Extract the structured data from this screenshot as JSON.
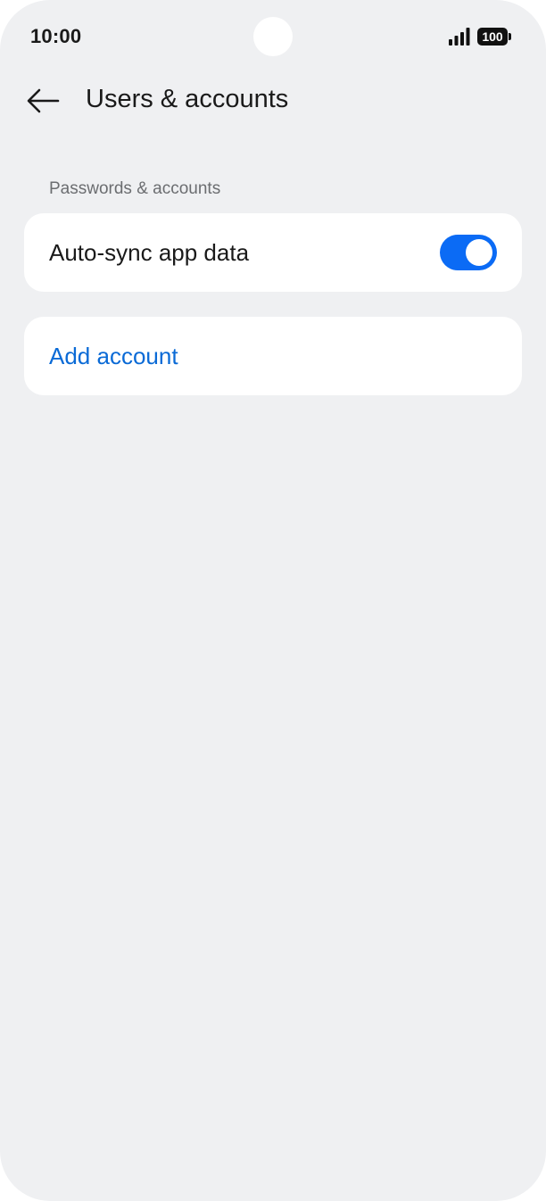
{
  "status_bar": {
    "time": "10:00",
    "battery_level": "100",
    "signal_icon": "signal-bars-icon"
  },
  "app_bar": {
    "back_icon": "arrow-left-icon",
    "title": "Users & accounts"
  },
  "section": {
    "header": "Passwords & accounts",
    "auto_sync_label": "Auto-sync app data",
    "auto_sync_enabled": true,
    "add_account_label": "Add account"
  },
  "colors": {
    "background": "#eff0f2",
    "card": "#ffffff",
    "accent": "#0b6bf5",
    "link": "#0a6ad6"
  }
}
